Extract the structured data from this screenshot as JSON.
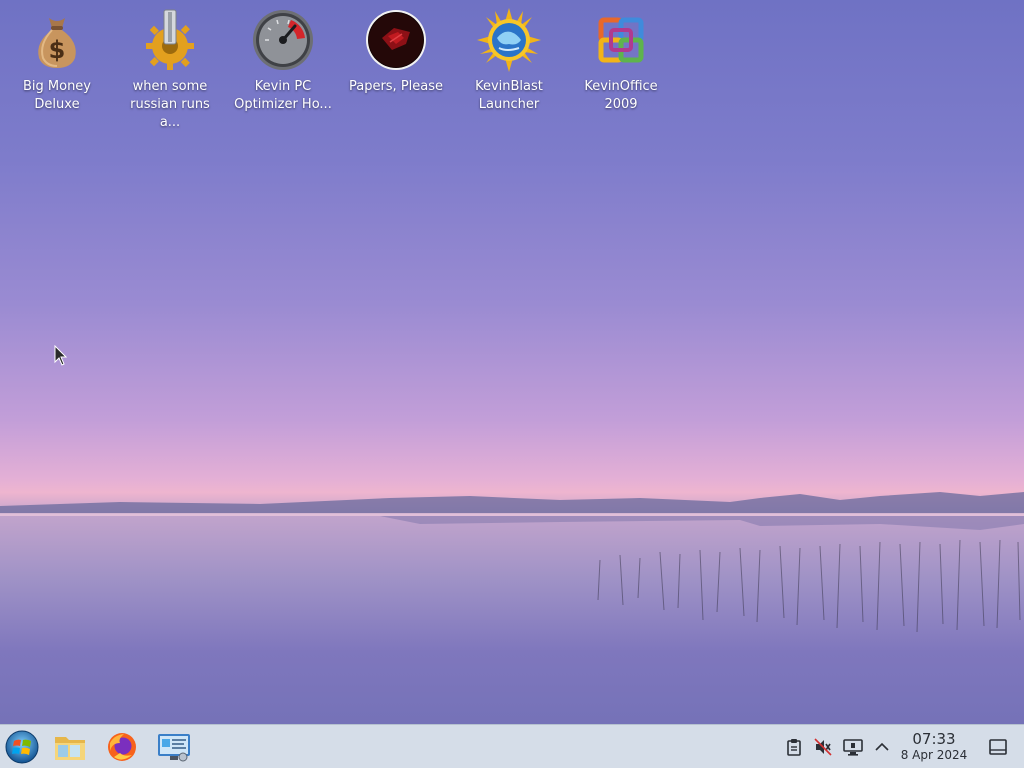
{
  "desktop": {
    "icons": [
      {
        "label": "Big Money\nDeluxe",
        "icon": "money-bag-icon"
      },
      {
        "label": "when some\nrussian runs a...",
        "icon": "gear-icon"
      },
      {
        "label": "Kevin PC\nOptimizer Ho...",
        "icon": "speedometer-icon"
      },
      {
        "label": "Papers, Please",
        "icon": "papers-please-icon"
      },
      {
        "label": "KevinBlast\nLauncher",
        "icon": "globe-sun-icon"
      },
      {
        "label": "KevinOffice\n2009",
        "icon": "office-logo-icon"
      }
    ]
  },
  "taskbar": {
    "launchers": [
      {
        "name": "start-menu",
        "icon": "start-orb-icon"
      },
      {
        "name": "file-manager",
        "icon": "folder-icon"
      },
      {
        "name": "firefox",
        "icon": "firefox-icon"
      },
      {
        "name": "control-panel",
        "icon": "control-panel-icon"
      }
    ],
    "tray": {
      "icons": [
        "clipboard-icon",
        "volume-muted-icon",
        "display-icon",
        "chevron-up-icon"
      ]
    },
    "clock": {
      "time": "07:33",
      "date": "8 Apr 2024"
    },
    "show_desktop_icon": "show-desktop-icon"
  }
}
